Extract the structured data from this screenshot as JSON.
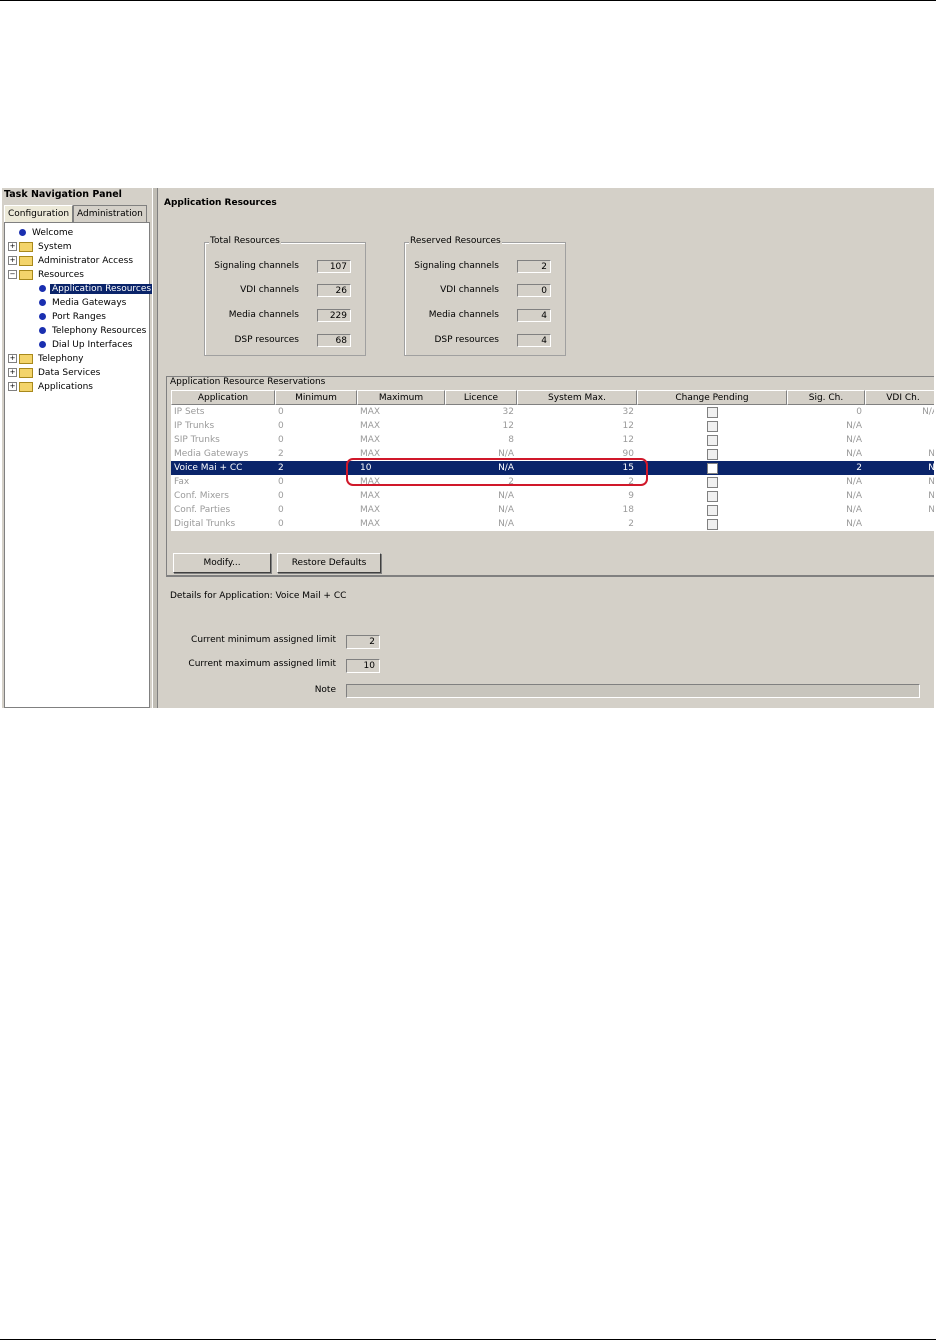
{
  "nav": {
    "title": "Task Navigation Panel",
    "tabs": [
      {
        "label": "Configuration"
      },
      {
        "label": "Administration"
      }
    ],
    "tree": [
      {
        "label": "Welcome",
        "type": "leaf"
      },
      {
        "label": "System",
        "type": "folder"
      },
      {
        "label": "Administrator Access",
        "type": "folder"
      },
      {
        "label": "Resources",
        "type": "folder-open"
      },
      {
        "label": "Application Resources",
        "type": "leaf",
        "selected": true
      },
      {
        "label": "Media Gateways",
        "type": "leaf"
      },
      {
        "label": "Port Ranges",
        "type": "leaf"
      },
      {
        "label": "Telephony Resources",
        "type": "leaf"
      },
      {
        "label": "Dial Up Interfaces",
        "type": "leaf"
      },
      {
        "label": "Telephony",
        "type": "folder"
      },
      {
        "label": "Data Services",
        "type": "folder"
      },
      {
        "label": "Applications",
        "type": "folder"
      }
    ]
  },
  "main": {
    "title": "Application Resources",
    "total": {
      "title": "Total Resources",
      "fields": [
        {
          "label": "Signaling channels",
          "value": "107"
        },
        {
          "label": "VDI channels",
          "value": "26"
        },
        {
          "label": "Media channels",
          "value": "229"
        },
        {
          "label": "DSP resources",
          "value": "68"
        }
      ]
    },
    "reserved": {
      "title": "Reserved Resources",
      "fields": [
        {
          "label": "Signaling channels",
          "value": "2"
        },
        {
          "label": "VDI channels",
          "value": "0"
        },
        {
          "label": "Media channels",
          "value": "4"
        },
        {
          "label": "DSP resources",
          "value": "4"
        }
      ]
    },
    "reservations": {
      "title": "Application Resource Reservations",
      "columns": [
        "Application",
        "Minimum",
        "Maximum",
        "Licence",
        "System Max.",
        "Change Pending",
        "Sig. Ch.",
        "VDI Ch."
      ],
      "rows": [
        [
          "IP Sets",
          "0",
          "MAX",
          "32",
          "32",
          "",
          "0",
          "N/A"
        ],
        [
          "IP Trunks",
          "0",
          "MAX",
          "12",
          "12",
          "",
          "N/A",
          ""
        ],
        [
          "SIP Trunks",
          "0",
          "MAX",
          "8",
          "12",
          "",
          "N/A",
          ""
        ],
        [
          "Media Gateways",
          "2",
          "MAX",
          "N/A",
          "90",
          "",
          "N/A",
          "N/"
        ],
        [
          "Voice Mai + CC",
          "2",
          "10",
          "N/A",
          "15",
          "",
          "2",
          "N/"
        ],
        [
          "Fax",
          "0",
          "MAX",
          "2",
          "2",
          "",
          "N/A",
          "N/"
        ],
        [
          "Conf. Mixers",
          "0",
          "MAX",
          "N/A",
          "9",
          "",
          "N/A",
          "N/"
        ],
        [
          "Conf. Parties",
          "0",
          "MAX",
          "N/A",
          "18",
          "",
          "N/A",
          "N/"
        ],
        [
          "Digital Trunks",
          "0",
          "MAX",
          "N/A",
          "2",
          "",
          "N/A",
          ""
        ]
      ],
      "selected_row": 4,
      "buttons": {
        "modify": "Modify...",
        "restore": "Restore Defaults"
      }
    },
    "details": {
      "title": "Details for Application: Voice Mail + CC",
      "min_label": "Current minimum assigned limit",
      "min_value": "2",
      "max_label": "Current maximum assigned limit",
      "max_value": "10",
      "note_label": "Note",
      "note_value": ""
    }
  },
  "colors": {
    "selection": "#0a246a",
    "highlight_ring": "#d0182a",
    "panel": "#d4d0c8"
  }
}
